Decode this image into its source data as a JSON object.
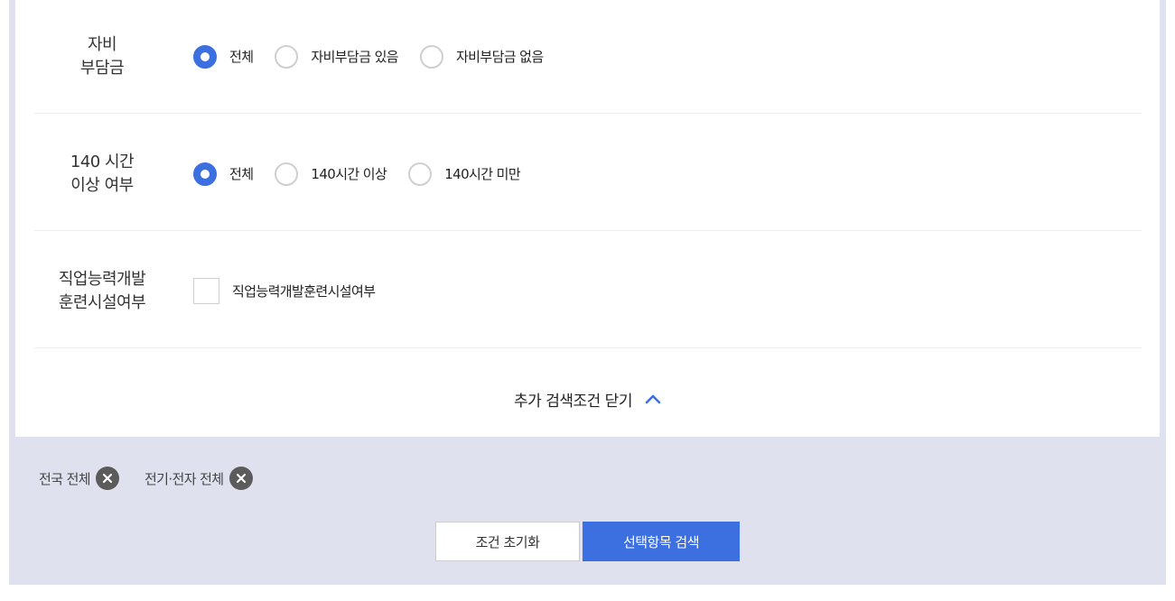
{
  "filters": [
    {
      "label": "자비\n부담금",
      "type": "radio",
      "options": [
        {
          "label": "전체",
          "selected": true
        },
        {
          "label": "자비부담금 있음",
          "selected": false
        },
        {
          "label": "자비부담금 없음",
          "selected": false
        }
      ]
    },
    {
      "label": "140 시간\n이상 여부",
      "type": "radio",
      "options": [
        {
          "label": "전체",
          "selected": true
        },
        {
          "label": "140시간 이상",
          "selected": false
        },
        {
          "label": "140시간 미만",
          "selected": false
        }
      ]
    },
    {
      "label": "직업능력개발\n훈련시설여부",
      "type": "checkbox",
      "options": [
        {
          "label": "직업능력개발훈련시설여부",
          "checked": false
        }
      ]
    }
  ],
  "toggle_advanced": {
    "label": "추가 검색조건 닫기",
    "icon": "chevron-up-icon"
  },
  "selected_tags": [
    {
      "label": "전국 전체",
      "icon": "close-circle-icon"
    },
    {
      "label": "전기·전자 전체",
      "icon": "close-circle-icon"
    }
  ],
  "actions": {
    "reset_label": "조건 초기화",
    "search_label": "선택항목 검색"
  },
  "colors": {
    "accent": "#3c6fe0",
    "frame": "#dfe2ee",
    "tag_close": "#5b5b5b"
  }
}
